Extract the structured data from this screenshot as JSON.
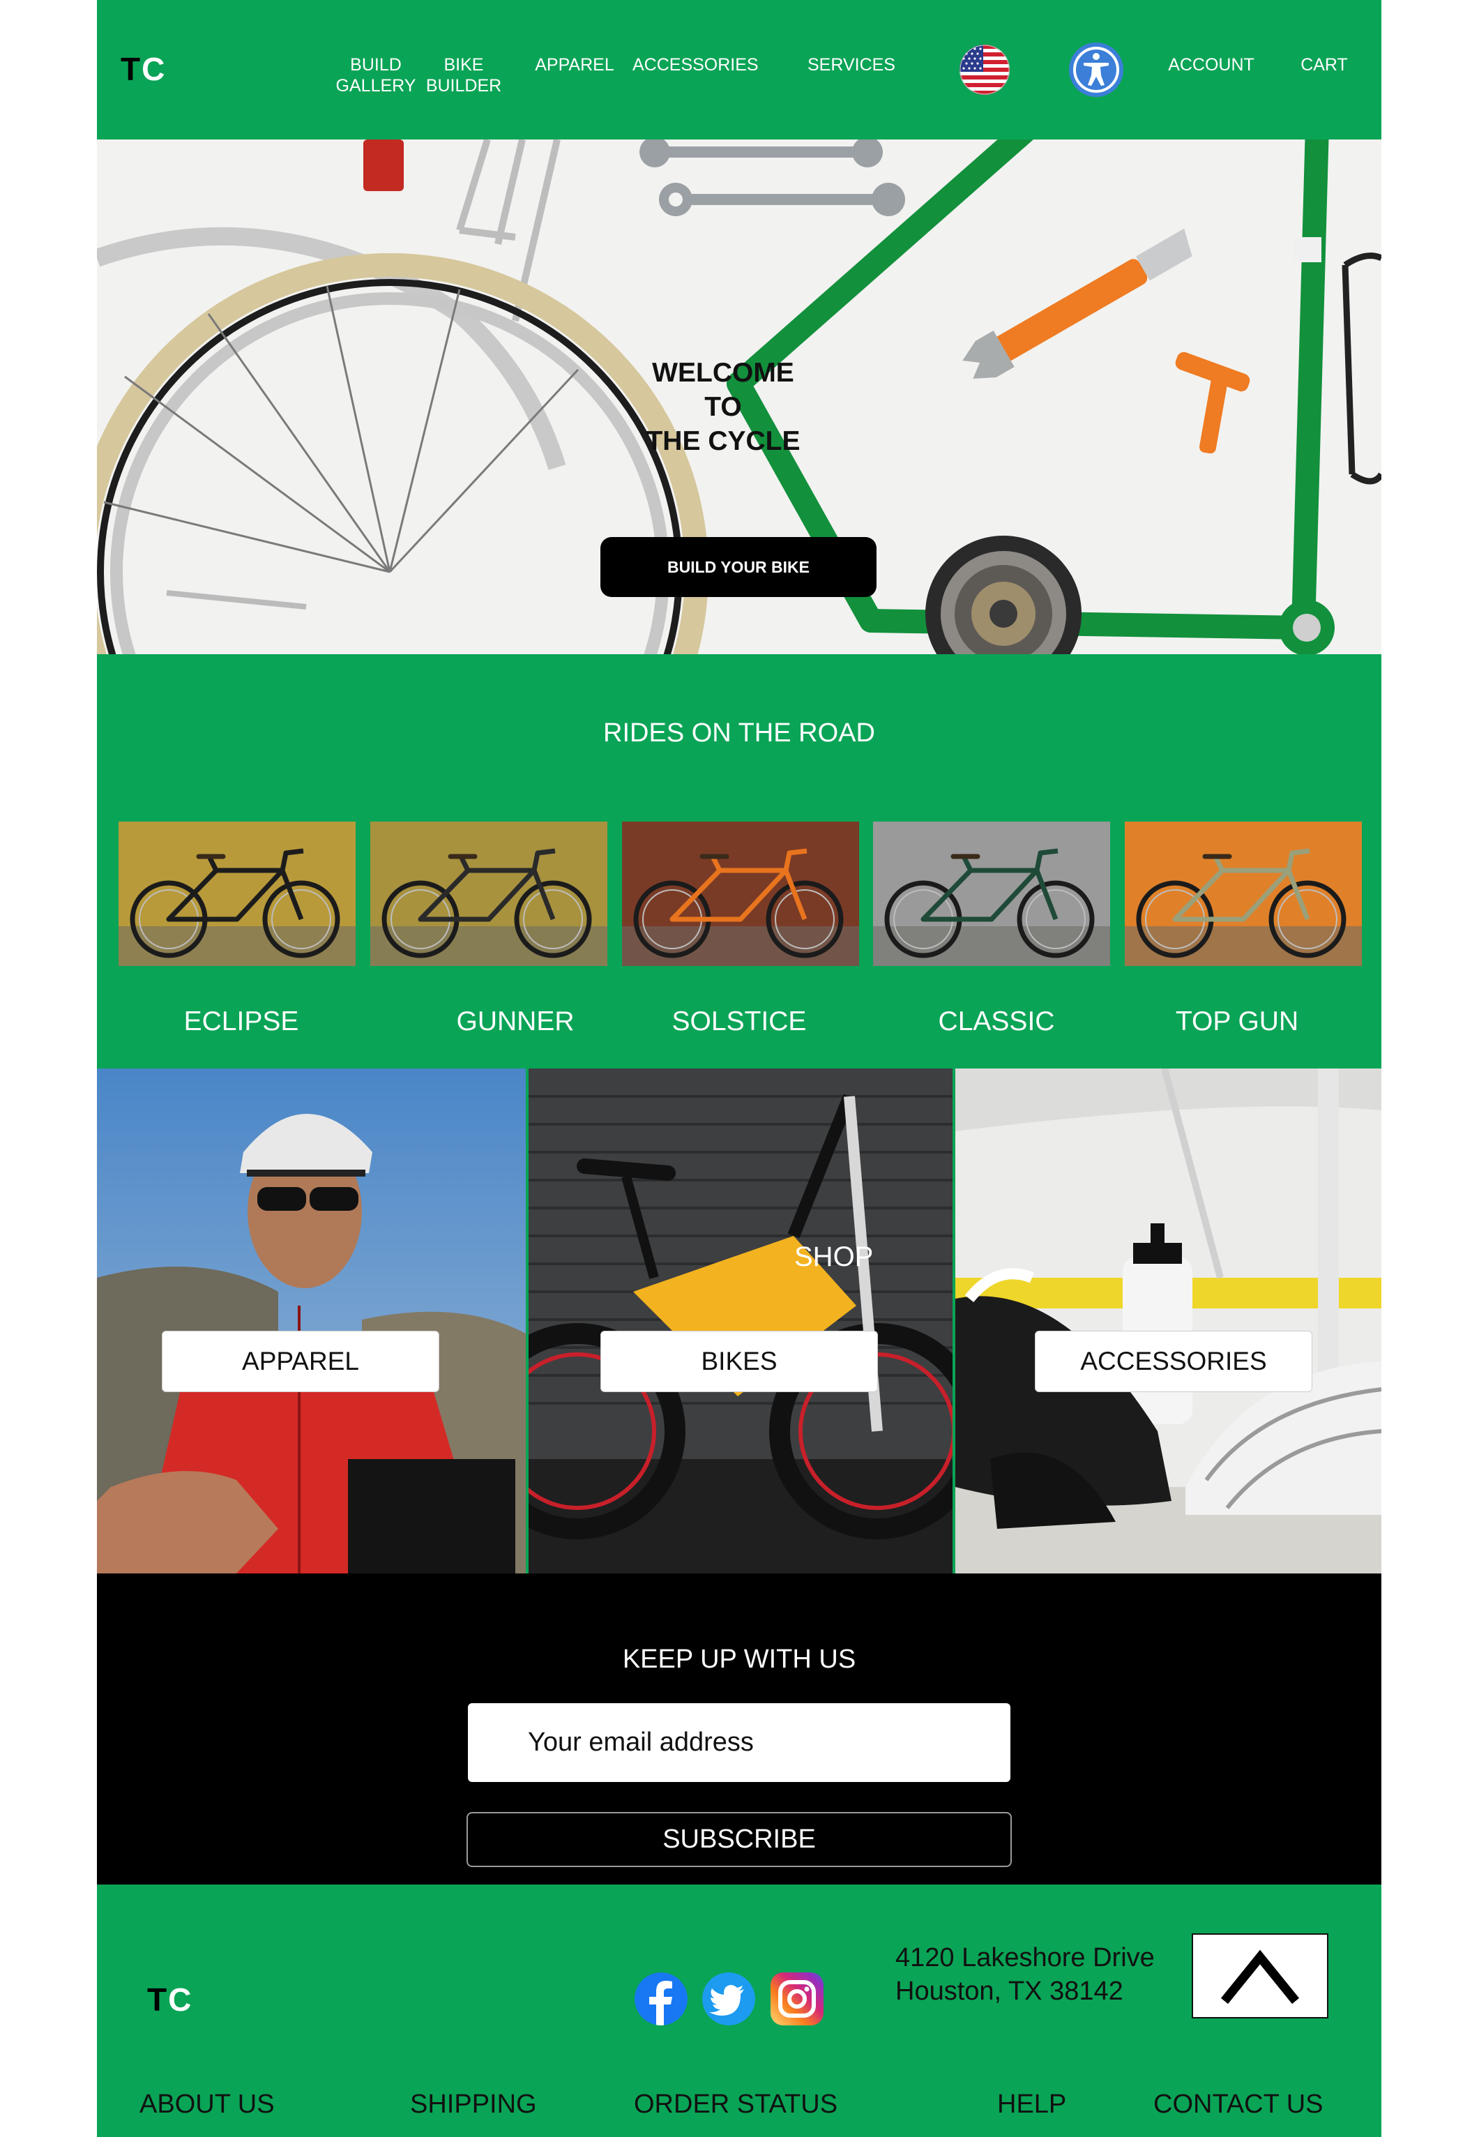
{
  "header": {
    "logo_t": "T",
    "logo_c": "C",
    "nav": [
      {
        "label": "BUILD\nGALLERY"
      },
      {
        "label": "BIKE\nBUILDER"
      },
      {
        "label": "APPAREL"
      },
      {
        "label": "ACCESSORIES"
      },
      {
        "label": "SERVICES"
      }
    ],
    "language_icon": "us-flag-icon",
    "accessibility_icon": "accessibility-icon",
    "account_label": "ACCOUNT",
    "cart_label": "CART"
  },
  "hero": {
    "title": "WELCOME\nTO\nTHE CYCLE",
    "cta_label": "BUILD YOUR BIKE"
  },
  "rides": {
    "title": "RIDES ON THE ROAD",
    "items": [
      {
        "label": "ECLIPSE",
        "wall": "#b89a3a",
        "frame": "#1c1c1c"
      },
      {
        "label": "GUNNER",
        "wall": "#a8923e",
        "frame": "#2a2a2a"
      },
      {
        "label": "SOLSTICE",
        "wall": "#7a3b26",
        "frame": "#e8741e"
      },
      {
        "label": "CLASSIC",
        "wall": "#9a9a9a",
        "frame": "#1f4a38"
      },
      {
        "label": "TOP GUN",
        "wall": "#e0812a",
        "frame": "#9aa07a"
      }
    ]
  },
  "shop": {
    "label": "SHOP",
    "apparel_label": "APPAREL",
    "bikes_label": "BIKES",
    "accessories_label": "ACCESSORIES"
  },
  "newsletter": {
    "title": "KEEP UP WITH US",
    "email_placeholder": "Your email address",
    "subscribe_label": "SUBSCRIBE"
  },
  "footer": {
    "logo_t": "T",
    "logo_c": "C",
    "social": [
      "facebook-icon",
      "twitter-icon",
      "instagram-icon"
    ],
    "address_line1": "4120 Lakeshore Drive",
    "address_line2": "Houston, TX 38142",
    "back_to_top_icon": "chevron-up-icon",
    "links": [
      {
        "label": "ABOUT US"
      },
      {
        "label": "SHIPPING"
      },
      {
        "label": "ORDER STATUS"
      },
      {
        "label": "HELP"
      },
      {
        "label": "CONTACT US"
      }
    ]
  },
  "colors": {
    "brand_green": "#0aa456",
    "button_black": "#000000",
    "text_white": "#ffffff"
  }
}
